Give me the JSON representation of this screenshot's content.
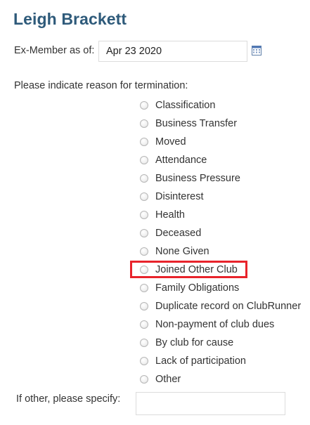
{
  "member": {
    "name": "Leigh Brackett"
  },
  "ex_member": {
    "label": "Ex-Member as of:",
    "date_value": "Apr 23 2020",
    "calendar_icon": "calendar-icon"
  },
  "termination": {
    "prompt": "Please indicate reason for termination:",
    "reasons": [
      {
        "label": "Classification"
      },
      {
        "label": "Business Transfer"
      },
      {
        "label": "Moved"
      },
      {
        "label": "Attendance"
      },
      {
        "label": "Business Pressure"
      },
      {
        "label": "Disinterest"
      },
      {
        "label": "Health"
      },
      {
        "label": "Deceased"
      },
      {
        "label": "None Given"
      },
      {
        "label": "Joined Other Club",
        "highlighted": true
      },
      {
        "label": "Family Obligations"
      },
      {
        "label": "Duplicate record on ClubRunner"
      },
      {
        "label": "Non-payment of club dues"
      },
      {
        "label": "By club for cause"
      },
      {
        "label": "Lack of participation"
      },
      {
        "label": "Other"
      }
    ],
    "highlight_color": "#e8232b"
  },
  "other": {
    "label": "If other, please specify:",
    "value": ""
  },
  "colors": {
    "title": "#2e5a7a",
    "text": "#333333",
    "input_border": "#dcdcdc"
  }
}
